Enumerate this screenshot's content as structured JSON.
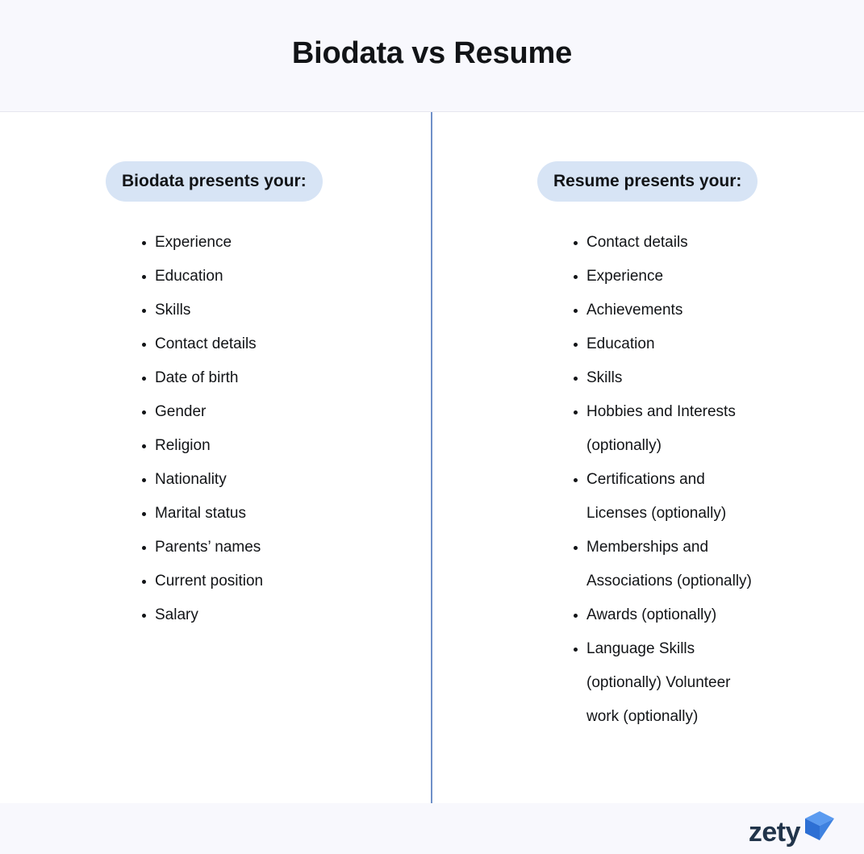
{
  "header": {
    "title": "Biodata vs Resume"
  },
  "columns": [
    {
      "id": "biodata",
      "heading": "Biodata presents your:",
      "items": [
        "Experience",
        "Education",
        "Skills",
        "Contact details",
        "Date of birth",
        "Gender",
        "Religion",
        "Nationality",
        "Marital status",
        "Parents’ names",
        "Current position",
        "Salary"
      ]
    },
    {
      "id": "resume",
      "heading": "Resume presents your:",
      "items": [
        "Contact details",
        "Experience",
        "Achievements",
        "Education",
        "Skills",
        "Hobbies and Interests (optionally)",
        "Certifications and Licenses (optionally)",
        "Memberships and Associations (optionally)",
        "Awards (optionally)",
        "Language Skills (optionally) Volunteer work (optionally)"
      ]
    }
  ],
  "footer": {
    "logo_text": "zety",
    "logo_icon": "zety-arrow-icon"
  },
  "colors": {
    "band_background": "#f8f8fd",
    "pill_background": "#d7e4f5",
    "divider": "#6f90c8",
    "text": "#121417",
    "logo_word": "#21344a",
    "logo_mark_light": "#4a90e8",
    "logo_mark_dark": "#2d6fd4"
  }
}
